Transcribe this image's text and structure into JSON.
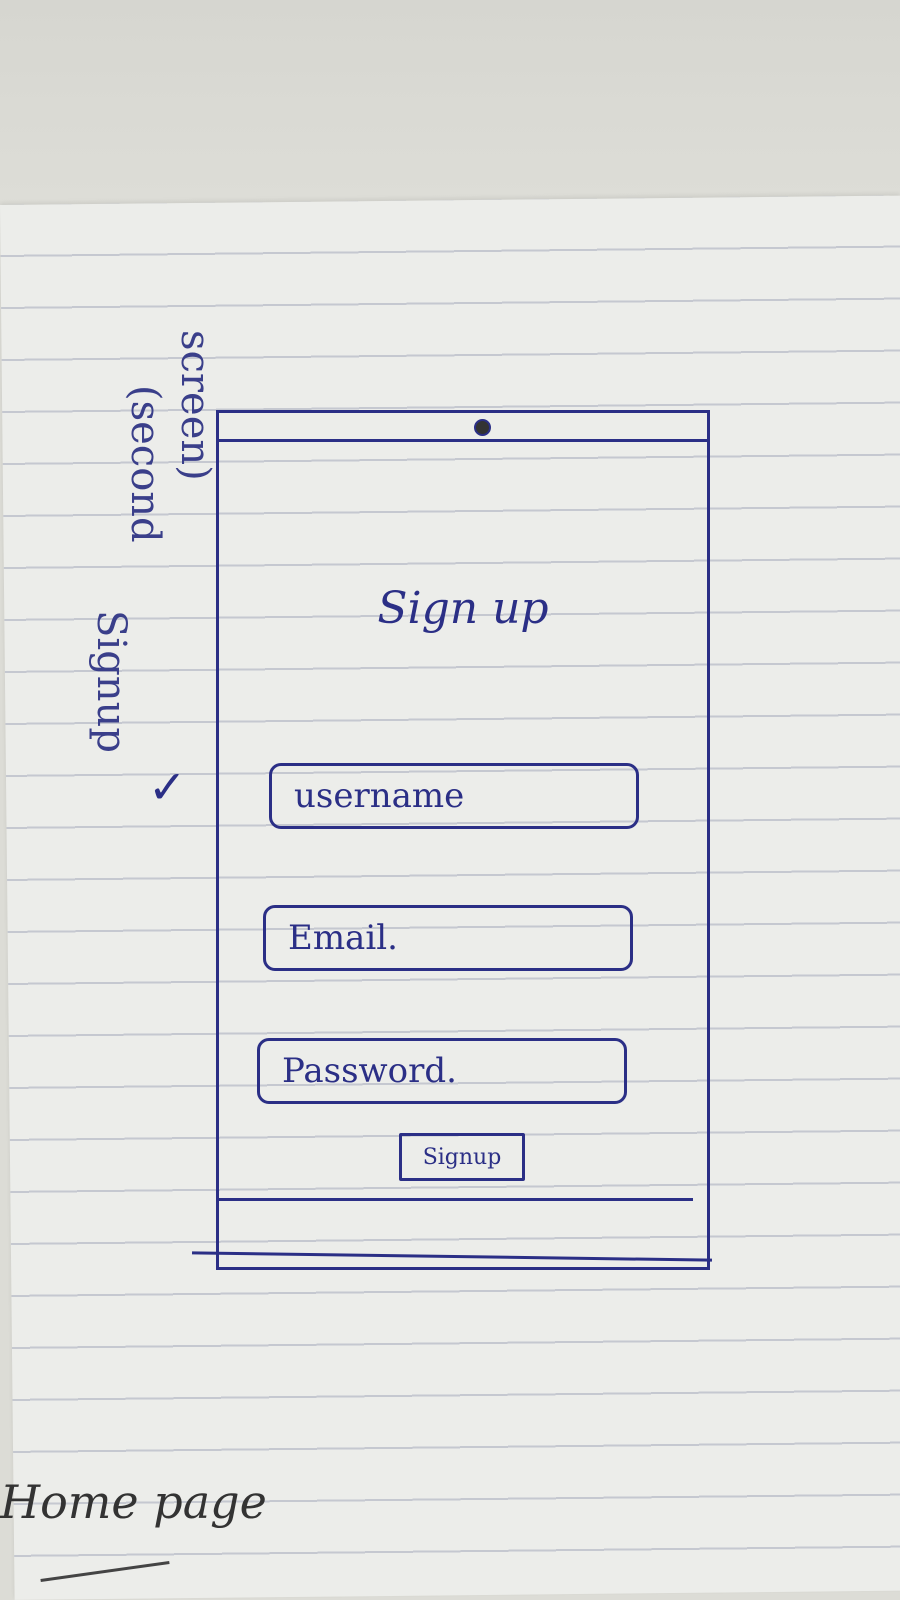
{
  "annotations": {
    "side_note_line1": "Signup",
    "side_note_line2": "(second",
    "side_note_line3": "screen)",
    "check_mark": "✓",
    "bottom_note": "Home page"
  },
  "screen": {
    "title": "Sign up",
    "fields": {
      "username_placeholder": "username",
      "email_placeholder": "Email.",
      "password_placeholder": "Password."
    },
    "signup_button_label": "Signup"
  },
  "colors": {
    "ink": "#2b2f86",
    "paper": "#ecedea",
    "rule_line": "#c5c8d0"
  }
}
